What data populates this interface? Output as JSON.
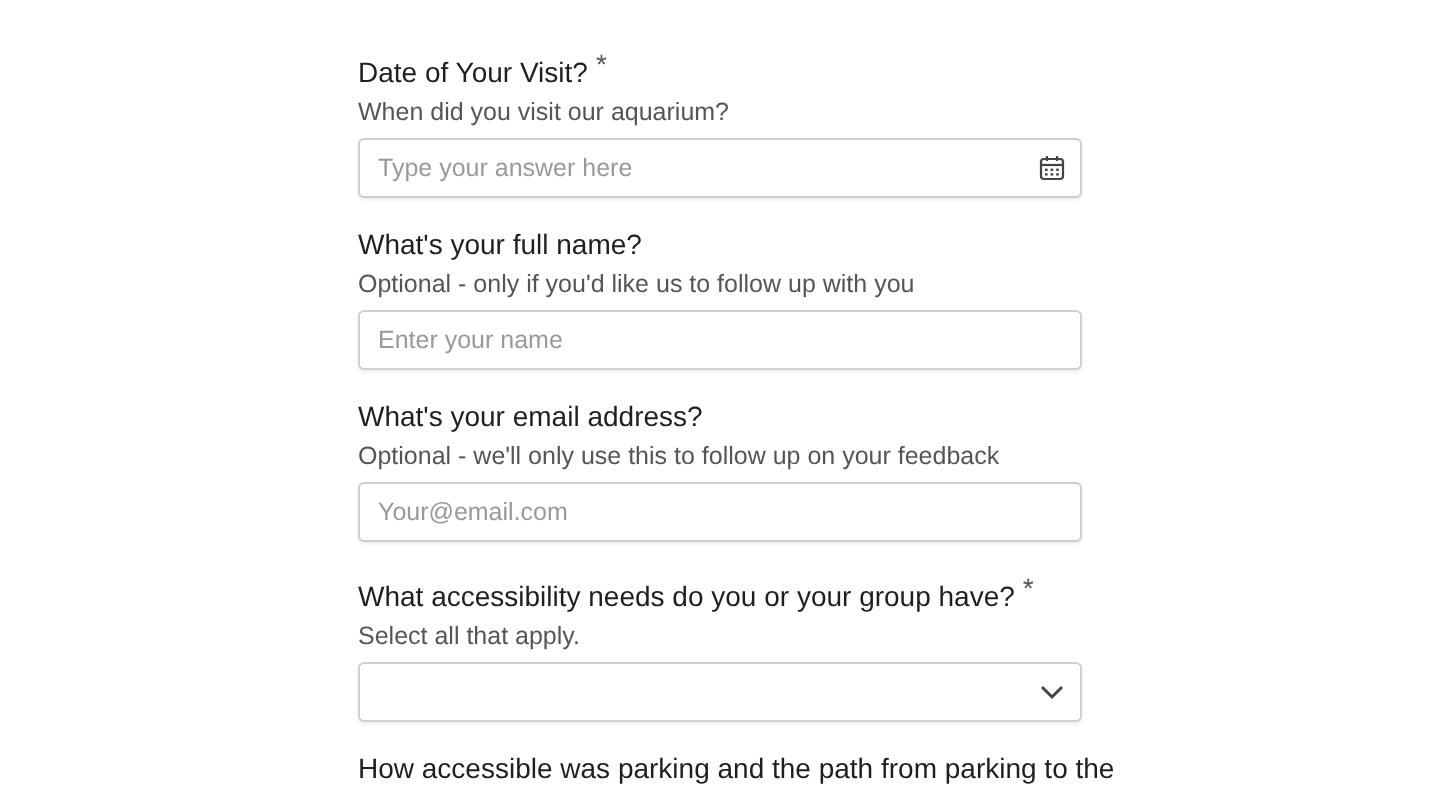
{
  "questions": [
    {
      "label": "Date of Your Visit?",
      "required_mark": "*",
      "description": "When did you visit our aquarium?",
      "field": {
        "kind": "date",
        "placeholder": "Type your answer here"
      }
    },
    {
      "label": "What's your full name?",
      "description": "Optional - only if you'd like us to follow up with you",
      "field": {
        "kind": "text",
        "placeholder": "Enter your name"
      }
    },
    {
      "label": "What's your email address?",
      "description": "Optional - we'll only use this to follow up on your feedback",
      "field": {
        "kind": "text",
        "placeholder": "Your@email.com"
      }
    },
    {
      "label": "What accessibility needs do you or your group have?",
      "required_mark": "*",
      "description": "Select all that apply.",
      "field": {
        "kind": "select"
      }
    },
    {
      "label": "How accessible was parking and the path from parking to the"
    }
  ]
}
